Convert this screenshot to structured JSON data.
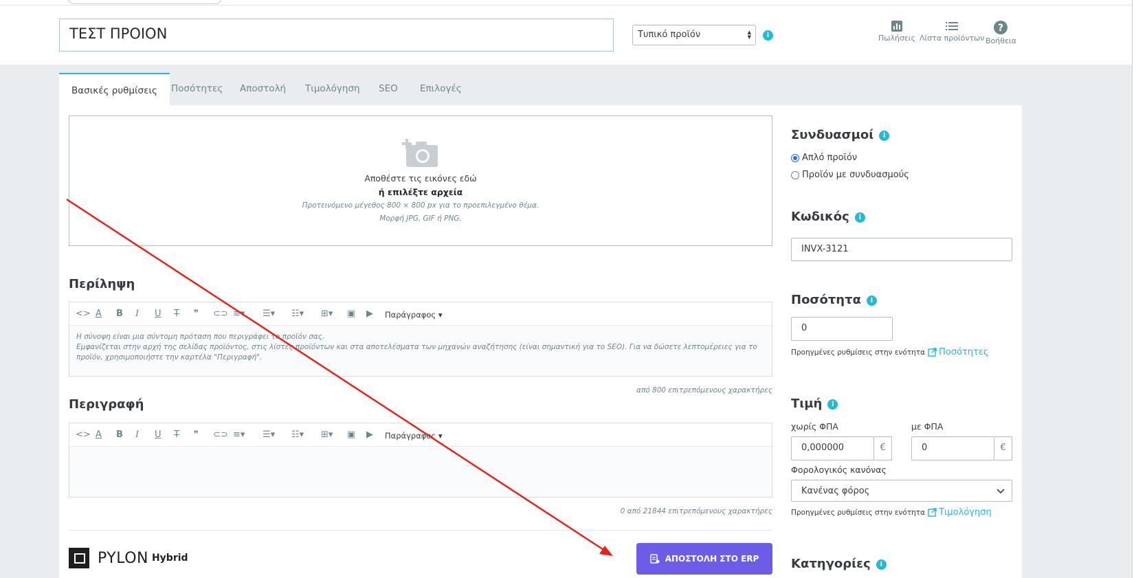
{
  "header": {
    "product_name": "ΤΕΣΤ ΠΡΟΙΟΝ",
    "product_type": "Τυπικό προϊόν",
    "tools": [
      {
        "label": "Πωλήσεις",
        "icon": "bar-chart-icon"
      },
      {
        "label": "Λίστα προϊόντων",
        "icon": "list-icon"
      },
      {
        "label": "Βοήθεια",
        "icon": "help-icon"
      }
    ]
  },
  "tabs": [
    "Βασικές ρυθμίσεις",
    "Ποσότητες",
    "Αποστολή",
    "Τιμολόγηση",
    "SEO",
    "Επιλογές"
  ],
  "dropzone": {
    "line1": "Αποθέστε τις εικόνες εδώ",
    "line2": "ή επιλέξτε αρχεία",
    "line3": "Προτεινόμενο μέγεθος 800 × 800 px για το προεπιλεγμένο θέμα.",
    "line4": "Μορφή JPG, GIF ή PNG."
  },
  "summary": {
    "title": "Περίληψη",
    "placeholder": "Η σύνοψη είναι μια σύντομη πρόταση που περιγράφει το προϊόν σας.\nΕμφανίζεται στην αρχή της σελίδας προϊόντος, στις λίστες προϊόντων και στα αποτελέσματα των μηχανών αναζήτησης (είναι σημαντική για το SEO). Για να δώσετε λεπτομέρειες για το προϊόν, χρησιμοποιήστε την καρτέλα \"Περιγραφή\".",
    "counter": "από 800 επιτρεπόμενους χαρακτήρες"
  },
  "description": {
    "title": "Περιγραφή",
    "counter": "0 από 21844 επιτρεπόμενους χαρακτήρες"
  },
  "editor_format": "Παράγραφος",
  "pylon": {
    "name": "PYLON",
    "sub": "Hybrid",
    "button": "ΑΠΟΣΤΟΛΗ ΣΤΟ ERP"
  },
  "side": {
    "combinations_title": "Συνδυασμοί",
    "combo_simple": "Απλό προϊόν",
    "combo_with": "Προϊόν με συνδυασμούς",
    "reference_title": "Κωδικός",
    "reference_value": "INVX-3121",
    "quantity_title": "Ποσότητα",
    "quantity_value": "0",
    "advanced_note": "Προηγμένες ρυθμίσεις στην ενότητα",
    "quantity_link": "Ποσότητες",
    "price_title": "Τιμή",
    "price_excl_label": "χωρίς ΦΠΑ",
    "price_excl_value": "0,000000",
    "price_incl_label": "με ΦΠΑ",
    "price_incl_value": "0",
    "currency": "€",
    "tax_rule_label": "Φορολογικός κανόνας",
    "tax_rule_value": "Κανένας φόρος",
    "pricing_link": "Τιμολόγηση",
    "categories_title": "Κατηγορίες"
  },
  "colors": {
    "accent": "#25b9d7",
    "erp_button": "#6c5ce7",
    "annotation_arrow": "#e8231c"
  }
}
